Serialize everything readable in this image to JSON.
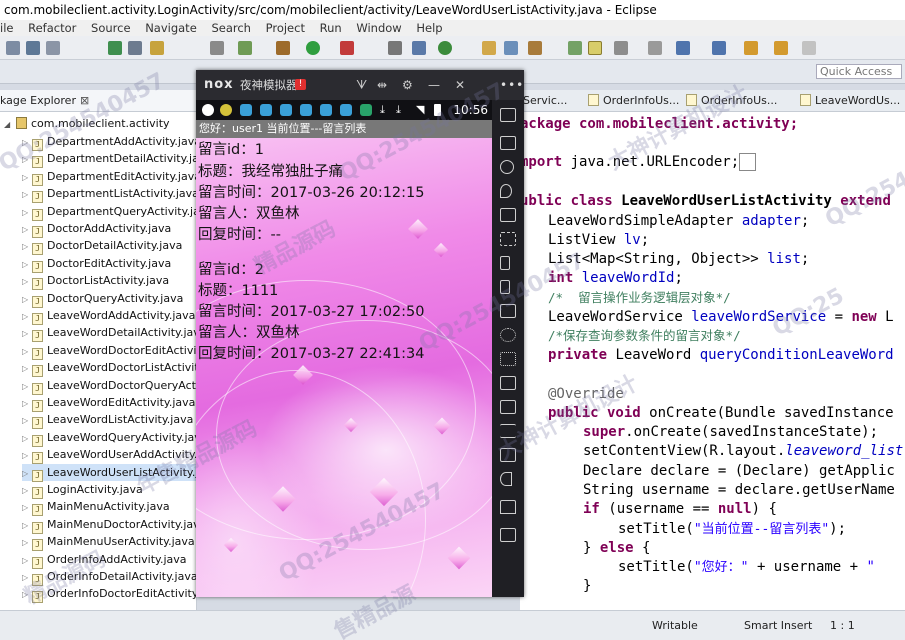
{
  "window": {
    "title": "com.mobileclient.activity.LoginActivity/src/com/mobileclient/activity/LeaveWordUserListActivity.java - Eclipse"
  },
  "menu": [
    "ile",
    "Refactor",
    "Source",
    "Navigate",
    "Search",
    "Project",
    "Run",
    "Window",
    "Help"
  ],
  "quick_access": "Quick Access",
  "package_explorer": {
    "tab_label": "kage Explorer",
    "tab_close": "⊠",
    "root": "com.mobileclient.activity",
    "files": [
      "DepartmentAddActivity.java",
      "DepartmentDetailActivity.java",
      "DepartmentEditActivity.java",
      "DepartmentListActivity.java",
      "DepartmentQueryActivity.java",
      "DoctorAddActivity.java",
      "DoctorDetailActivity.java",
      "DoctorEditActivity.java",
      "DoctorListActivity.java",
      "DoctorQueryActivity.java",
      "LeaveWordAddActivity.java",
      "LeaveWordDetailActivity.java",
      "LeaveWordDoctorEditActivity",
      "LeaveWordDoctorListActivity",
      "LeaveWordDoctorQueryActivi",
      "LeaveWordEditActivity.java",
      "LeaveWordListActivity.java",
      "LeaveWordQueryActivity.java",
      "LeaveWordUserAddActivity.java",
      "LeaveWordUserListActivity.java",
      "LoginActivity.java",
      "MainMenuActivity.java",
      "MainMenuDoctorActivity.java",
      "MainMenuUserActivity.java",
      "OrderInfoAddActivity.java",
      "OrderInfoDetailActivity.java",
      "OrderInfoDoctorEditActivity.java"
    ]
  },
  "editor_tabs": [
    "Servic...",
    "OrderInfoUs...",
    "OrderInfoUs...",
    "LeaveWordUs..."
  ],
  "code": {
    "l1": "ackage com.mobileclient.activity;",
    "l2_kw": "mport",
    "l2": " java.net.URLEncoder;",
    "l3_kw": "ublic class",
    "l3": " LeaveWordUserListActivity ",
    "l3_kw2": "extend",
    "l4": "LeaveWordSimpleAdapter ",
    "l4_f": "adapter",
    "l5": "ListView ",
    "l5_f": "lv",
    "l6": "List<Map<String, Object>> ",
    "l6_f": "list",
    "l7_kw": "int",
    "l7_f": " leaveWordId",
    "l8": "/*  留言操作业务逻辑层对象*/",
    "l9": "LeaveWordService ",
    "l9_f": "leaveWordService",
    "l9_b": " = ",
    "l9_kw": "new",
    "l9_c": " L",
    "l10": "/*保存查询参数条件的留言对象*/",
    "l11_kw": "private",
    "l11": " LeaveWord ",
    "l11_f": "queryConditionLeaveWord",
    "l12": "@Override",
    "l13_kw": "public void",
    "l13": " onCreate(Bundle savedInstance",
    "l14_kw": "super",
    "l14": ".onCreate(savedInstanceState);",
    "l15": "setContentView(R.layout.",
    "l15_f": "leaveword_list",
    "l16": "Declare declare = (Declare) getApplic",
    "l17": "String username = declare.getUserName",
    "l18_kw": "if",
    "l18": " (username == ",
    "l18_kw2": "null",
    "l18_b": ") {",
    "l19": "setTitle(",
    "l19_s": "\"当前位置--留言列表\"",
    "l19_b": ");",
    "l20": "} ",
    "l20_kw": "else",
    "l20_b": " {",
    "l21": "setTitle(",
    "l21_s": "\"您好：\"",
    "l21_b": " + username + ",
    "l21_s2": "\"",
    "l22": "}"
  },
  "status_bar": {
    "mode": "Writable",
    "insert": "Smart Insert",
    "position": "1 : 1"
  },
  "emulator": {
    "logo": "nox",
    "name": "夜神模拟器",
    "badge": "!",
    "controls": [
      "ᗐ",
      "⇹",
      "⚙",
      "—",
      "✕"
    ],
    "clock": "10:56",
    "app_title": "您好：user1  当前位置---留言列表",
    "messages": [
      {
        "id": "留言id：1",
        "title": "标题：我经常独肚子痛",
        "time": "留言时间：2017-03-26 20:12:15",
        "person": "留言人：双鱼林",
        "reply": "回复时间：--"
      },
      {
        "id": "留言id：2",
        "title": "标题：1111",
        "time": "留言时间：2017-03-27 17:02:50",
        "person": "留言人：双鱼林",
        "reply": "回复时间：2017-03-27 22:41:34"
      }
    ],
    "side_dots": "•••"
  },
  "watermarks": [
    "QQ:254540457",
    "QQ:254540457",
    "QQ:25454",
    "QQ:254540457",
    "大神计算机设计",
    "精品源码",
    "年售精品源码",
    "大神计算机设计",
    "QQ:254540457",
    "售精品源",
    "精品源码",
    "QQ:25"
  ],
  "colors": {
    "editor_keyword": "#7f0055",
    "editor_field": "#0000c0",
    "editor_comment": "#3f7f5f",
    "editor_string": "#2a00ff",
    "emulator_frame": "#1f1f24",
    "app_titlebar": "#787878"
  }
}
